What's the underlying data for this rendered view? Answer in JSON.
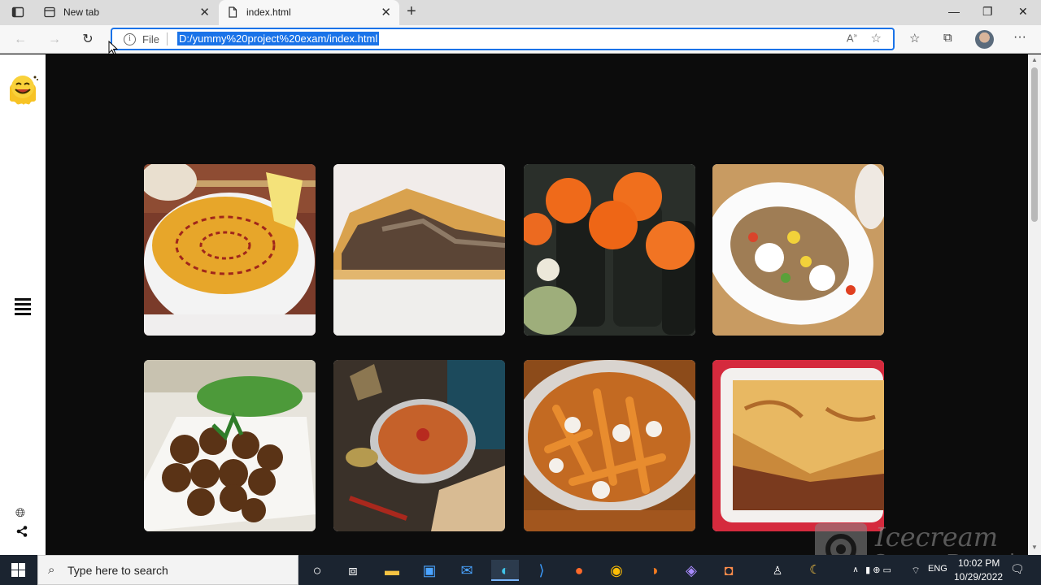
{
  "browser": {
    "tabs": [
      {
        "label": "New tab",
        "active": false
      },
      {
        "label": "index.html",
        "active": true
      }
    ],
    "address": {
      "security_label": "File",
      "url": "D:/yummy%20project%20exam/index.html"
    }
  },
  "page": {
    "background": "#0c0c0c",
    "sidebar": {
      "icons": [
        "smiley-logo",
        "menu-icon",
        "globe-icon",
        "share-icon"
      ]
    },
    "food_cards": [
      {
        "name": "lentil-soup"
      },
      {
        "name": "meat-pie"
      },
      {
        "name": "sushi-rolls"
      },
      {
        "name": "stuffed-potato"
      },
      {
        "name": "falafel"
      },
      {
        "name": "spiced-soup"
      },
      {
        "name": "poutine"
      },
      {
        "name": "lasagna"
      }
    ]
  },
  "taskbar": {
    "search_placeholder": "Type here to search",
    "language": "ENG",
    "time": "10:02 PM",
    "date": "10/29/2022"
  },
  "watermark": {
    "title": "Icecream",
    "subtitle": "Screen Recorder"
  }
}
